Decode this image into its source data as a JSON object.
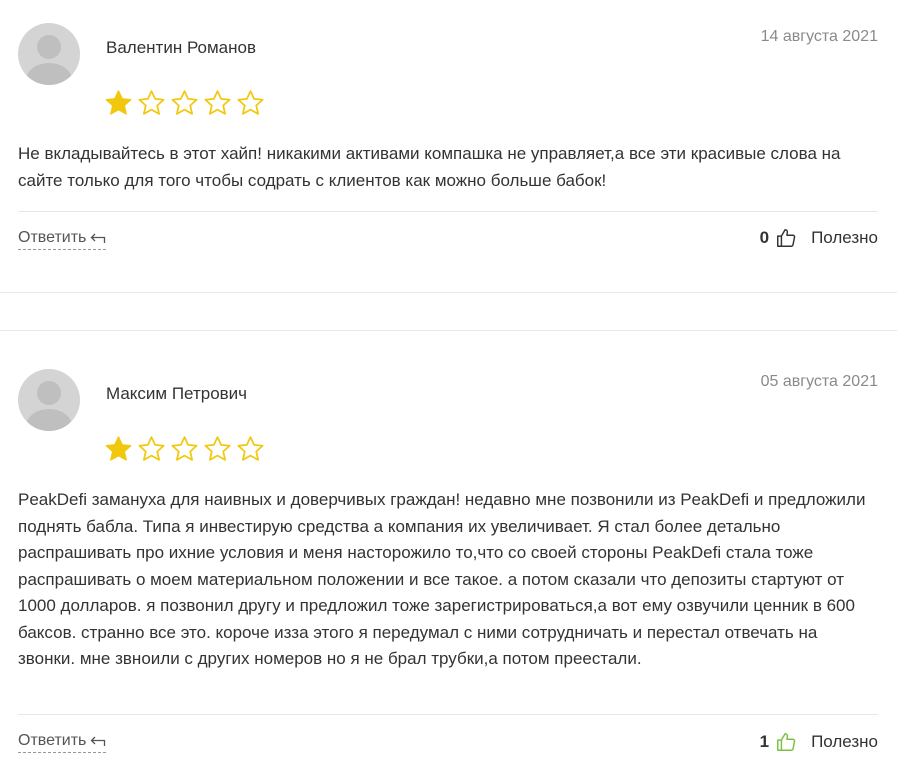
{
  "reviews": [
    {
      "author": "Валентин Романов",
      "date": "14 августа 2021",
      "rating": 1,
      "max_rating": 5,
      "text": "Не вкладывайтесь в этот хайп! никакими активами компашка не управляет,а все эти красивые слова на сайте только для того чтобы содрать с клиентов как можно больше бабок!",
      "reply_label": "Ответить",
      "helpful_count": "0",
      "helpful_label": "Полезно",
      "like_icon": "thumbs-up-icon",
      "like_color": "#333333"
    },
    {
      "author": "Максим Петрович",
      "date": "05 августа 2021",
      "rating": 1,
      "max_rating": 5,
      "text": "PeakDefi замануха для наивных и доверчивых граждан! недавно мне позвонили из PeakDefi и предложили поднять бабла. Типа я инвестирую средства а компания их увеличивает. Я стал более детально распрашивать про ихние условия и меня насторожило то,что со своей стороны PeakDefi стала тоже распрашивать о моем материальном положении и все такое. а потом сказали что депозиты стартуют от 1000 долларов. я позвонил другу и предложил тоже зарегистрироваться,а вот ему озвучили ценник в 600 баксов. странно все это. короче изза этого я передумал с ними сотрудничать и перестал отвечать на звонки. мне звноили с других номеров но я не брал трубки,а потом преестали.",
      "reply_label": "Ответить",
      "helpful_count": "1",
      "helpful_label": "Полезно",
      "like_icon": "thumbs-up-icon",
      "like_color": "#7cc242"
    }
  ],
  "colors": {
    "star_filled": "#f2c80f",
    "star_empty": "#f2c80f",
    "text": "#333333",
    "date": "#8a8a8a",
    "divider": "#e8e8e8"
  }
}
